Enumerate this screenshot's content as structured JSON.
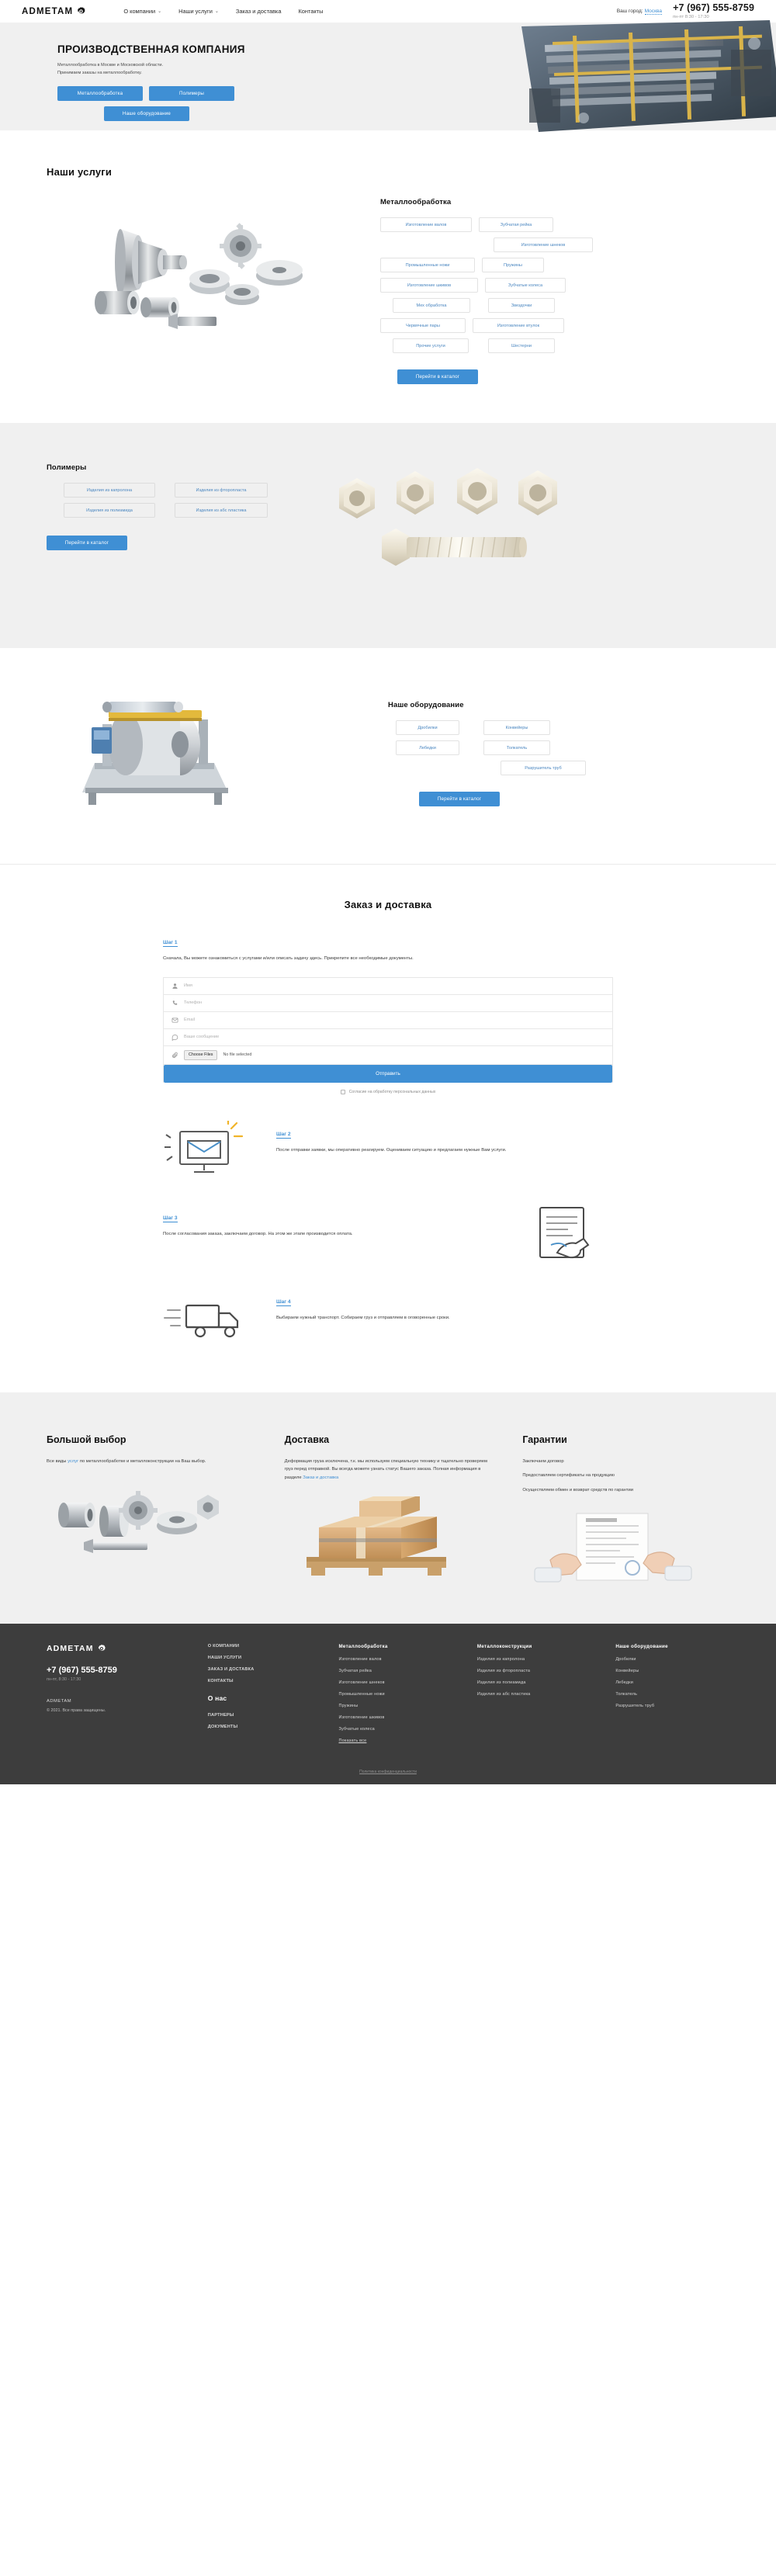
{
  "brand": {
    "name": "ADMETAM",
    "logo_icon": "gear-icon"
  },
  "header": {
    "nav": [
      {
        "label": "О компании",
        "has_dropdown": true
      },
      {
        "label": "Наши услуги",
        "has_dropdown": true
      },
      {
        "label": "Заказ и доставка",
        "has_dropdown": false
      },
      {
        "label": "Контакты",
        "has_dropdown": false
      }
    ],
    "city_label": "Ваш город:",
    "city_value": "Москва",
    "phone": "+7 (967) 555-8759",
    "hours": "пн-пт 8:30 - 17:30"
  },
  "hero": {
    "title": "ПРОИЗВОДСТВЕННАЯ КОМПАНИЯ",
    "subtitle": "Металлообработка в Москве и Московской области.\nПринимаем заказы на металлообработку.",
    "buttons": [
      "Металлообработка",
      "Полимеры",
      "Наше оборудование"
    ]
  },
  "services": {
    "heading": "Наши услуги",
    "subheading": "Металлообработка",
    "chips": [
      "Изготовление валов",
      "Зубчатая рейка",
      "Изготовление шнеков",
      "Промышленные ножи",
      "Пружины",
      "Изготовление шкивов",
      "Зубчатые колеса",
      "Мех обработка",
      "Звездочки",
      "Червячные пары",
      "Изготовление втулок",
      "Прочие услуги",
      "Шестерни"
    ],
    "cta": "Перейти в каталог"
  },
  "polymers": {
    "heading": "Полимеры",
    "chips": [
      "Изделия из капролона",
      "Изделия из фторопласта",
      "Изделия из полиамида",
      "Изделия из абс пластика"
    ],
    "cta": "Перейти в каталог"
  },
  "equipment": {
    "heading": "Наше оборудование",
    "chips": [
      "Дробилки",
      "Конвейеры",
      "Лебедки",
      "Толкатель",
      "Разрушитель труб"
    ],
    "cta": "Перейти в каталог"
  },
  "order": {
    "heading": "Заказ и доставка",
    "steps": [
      {
        "label": "Шаг 1",
        "text": "Сначала, Вы можете ознакомиться с услугами и/или описать задачу здесь. Прикрепите все необходимые документы."
      },
      {
        "label": "Шаг 2",
        "text": "После отправки заявки, мы оперативно реагируем. Оцениваем ситуацию и предлагаем нужные Вам услуги.",
        "icon": "monitor-mail-icon"
      },
      {
        "label": "Шаг 3",
        "text": "После согласования заказа, заключаем договор. На этом же этапе производится оплата.",
        "icon": "contract-sign-icon"
      },
      {
        "label": "Шаг 4",
        "text": "Выбираем нужный транспорт. Собираем груз и отправляем в оговоренные сроки.",
        "icon": "truck-icon"
      }
    ],
    "form": {
      "name_placeholder": "Имя",
      "phone_placeholder": "Телефон",
      "email_placeholder": "Email",
      "message_placeholder": "Ваше сообщение",
      "file_button": "Choose Files",
      "file_status": "No file selected",
      "submit": "Отправить",
      "consent": "Согласие на обработку персональных данных"
    }
  },
  "advantages": [
    {
      "title": "Большой выбор",
      "text_before": "Все виды ",
      "link": "услуг",
      "text_after": " по металлообработке и металлоконструкции на Ваш выбор.",
      "image": "metal-parts-photo"
    },
    {
      "title": "Доставка",
      "text": "Деформация груза исключена, т.к. мы используем специальную технику и тщательно проверяем груз перед отправкой. Вы всегда можете узнать статус Вашего заказа. Полная информация в разделе ",
      "link": "Заказ и доставка",
      "image": "package-photo"
    },
    {
      "title": "Гарантии",
      "lines": [
        "Заключаем договор",
        "Предоставляем сертификаты на продукцию",
        "Осуществляем обмен и возврат средств по гарантии"
      ],
      "image": "certificate-photo"
    }
  ],
  "footer": {
    "phone": "+7 (967) 555-8759",
    "hours": "пн-пт, 8:30 - 17:30",
    "brand": "ADMETAM",
    "copyright": "© 2021. Все права защищены.",
    "col_company": {
      "links": [
        "О КОМПАНИИ",
        "НАШИ УСЛУГИ",
        "ЗАКАЗ И ДОСТАВКА",
        "КОНТАКТЫ"
      ],
      "big": "О нас",
      "links2": [
        "ПАРТНЕРЫ",
        "ДОКУМЕНТЫ"
      ]
    },
    "col_metal": {
      "head": "Металлообработка",
      "links": [
        "Изготовление валов",
        "Зубчатая рейка",
        "Изготовление шнеков",
        "Промышленные ножи",
        "Пружины",
        "Изготовление шкивов",
        "Зубчатые колеса",
        "Показать все"
      ]
    },
    "col_constructions": {
      "head": "Металлоконструкции",
      "links": [
        "Изделия из капролона",
        "Изделия из фторопласта",
        "Изделия из полиамида",
        "Изделия из абс пластика"
      ]
    },
    "col_equipment": {
      "head": "Наше оборудование",
      "links": [
        "Дробилки",
        "Конвейеры",
        "Лебедки",
        "Толкатель",
        "Разрушитель труб"
      ]
    },
    "bottom": "Политика конфиденциальности"
  },
  "colors": {
    "accent": "#3f8fd4",
    "footer_bg": "#3d3d3d",
    "band_bg": "#f0f0f0"
  }
}
